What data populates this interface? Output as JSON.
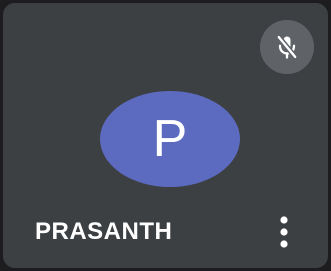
{
  "participant": {
    "name": "PRASANTH",
    "initial": "P"
  },
  "icons": {
    "mute": "mic-off-icon",
    "more": "more-vert-icon"
  },
  "colors": {
    "tile_background": "#3c4043",
    "avatar_background": "#5c6bc0",
    "mute_badge_background": "#5f6368",
    "text": "#ffffff"
  }
}
